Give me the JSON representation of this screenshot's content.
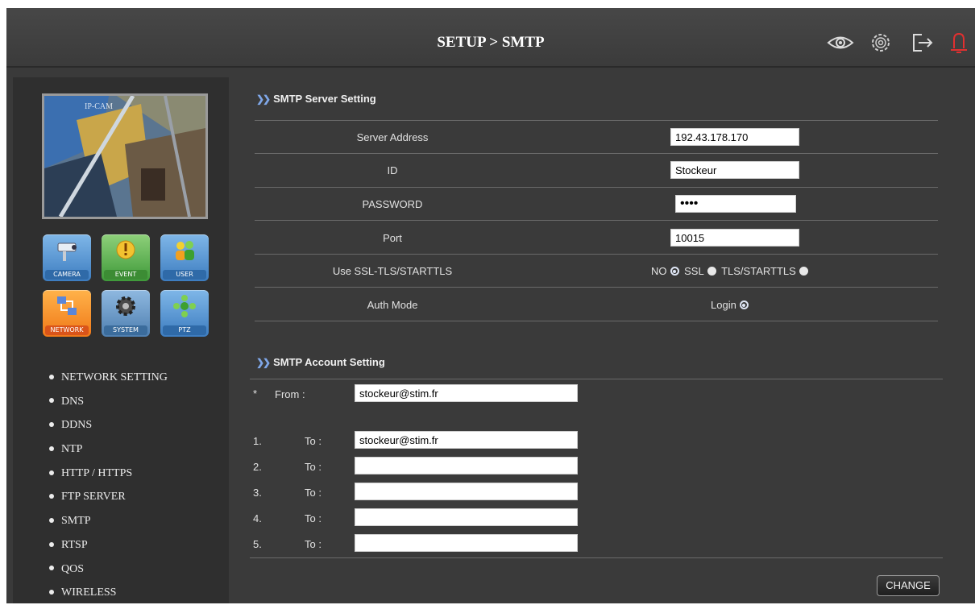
{
  "header": {
    "title": "SETUP > SMTP",
    "icons": [
      "eye-icon",
      "gear-icon",
      "logout-icon",
      "alarm-bell-icon"
    ]
  },
  "sidebar": {
    "preview_overlay": "IP-CAM",
    "icon_buttons": [
      {
        "label": "CAMERA",
        "icon": "camera-icon"
      },
      {
        "label": "EVENT",
        "icon": "event-icon"
      },
      {
        "label": "USER",
        "icon": "user-icon"
      },
      {
        "label": "NETWORK",
        "icon": "network-icon"
      },
      {
        "label": "SYSTEM",
        "icon": "system-gear-icon"
      },
      {
        "label": "PTZ",
        "icon": "ptz-icon"
      }
    ],
    "menu": [
      "NETWORK SETTING",
      "DNS",
      "DDNS",
      "NTP",
      "HTTP / HTTPS",
      "FTP SERVER",
      "SMTP",
      "RTSP",
      "QOS",
      "WIRELESS"
    ]
  },
  "server": {
    "heading": "SMTP Server Setting",
    "address_label": "Server Address",
    "address_value": "192.43.178.170",
    "id_label": "ID",
    "id_value": "Stockeur",
    "password_label": "PASSWORD",
    "password_value": "1234",
    "port_label": "Port",
    "port_value": "10015",
    "ssl_label": "Use SSL-TLS/STARTTLS",
    "ssl_options": [
      "NO",
      "SSL",
      "TLS/STARTTLS"
    ],
    "ssl_selected": "NO",
    "auth_label": "Auth Mode",
    "auth_option": "Login"
  },
  "account": {
    "heading": "SMTP Account Setting",
    "from_marker": "*",
    "from_label": "From :",
    "from_value": "stockeur@stim.fr",
    "to_label": "To :",
    "recipients": [
      {
        "num": "1.",
        "value": "stockeur@stim.fr"
      },
      {
        "num": "2.",
        "value": ""
      },
      {
        "num": "3.",
        "value": ""
      },
      {
        "num": "4.",
        "value": ""
      },
      {
        "num": "5.",
        "value": ""
      }
    ]
  },
  "actions": {
    "change_label": "CHANGE"
  },
  "colors": {
    "background": "#3a3a3a",
    "sidebar": "#2f2f2f",
    "accent": "#7fa7e8",
    "alarm": "#e03030"
  }
}
